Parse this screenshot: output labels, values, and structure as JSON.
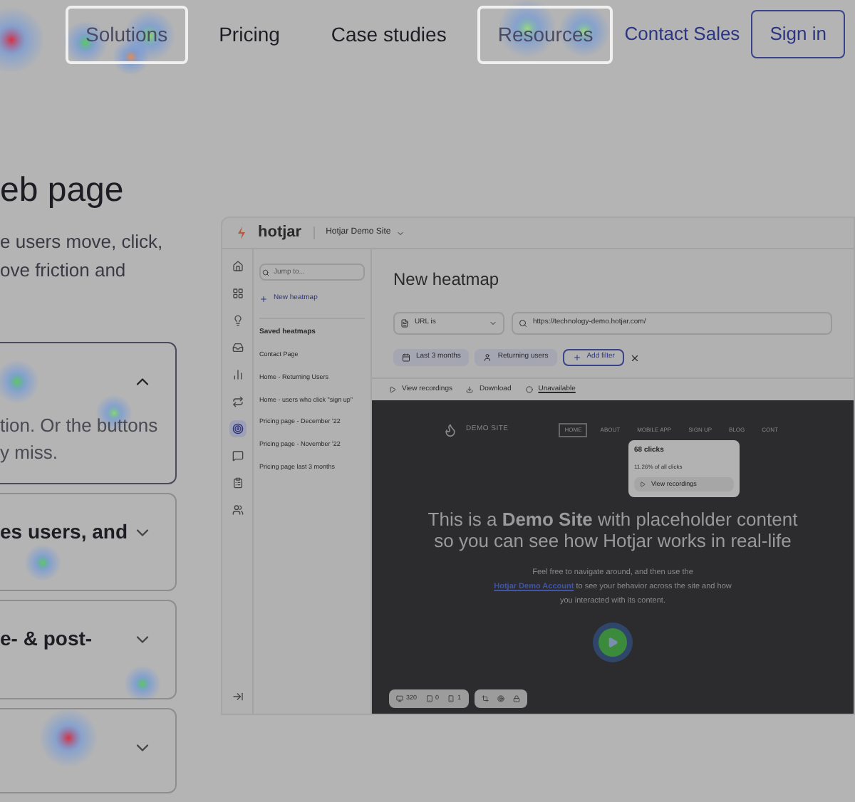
{
  "nav": {
    "items": [
      {
        "label": "Solutions",
        "highlighted": true
      },
      {
        "label": "Pricing",
        "highlighted": false
      },
      {
        "label": "Case studies",
        "highlighted": false
      },
      {
        "label": "Resources",
        "highlighted": true
      }
    ],
    "contact": "Contact Sales",
    "sign_in": "Sign in"
  },
  "hero": {
    "heading": "eb page",
    "lines": [
      "e users move, click,",
      "ove friction and"
    ]
  },
  "accordion": [
    {
      "expanded": true,
      "body": [
        "tion. Or the buttons",
        "y miss."
      ]
    },
    {
      "title": "es users, and",
      "expanded": false
    },
    {
      "title": "e- & post-",
      "expanded": false
    },
    {
      "expanded": false
    }
  ],
  "app": {
    "logo": "hotjar",
    "site": "Hotjar Demo Site",
    "search": {
      "placeholder": "Jump to..."
    },
    "new_button": "New heatmap",
    "saved_title": "Saved heatmaps",
    "saved": [
      "Contact Page",
      "Home - Returning Users",
      "Home - users who click \"sign up\"",
      "Pricing page - December '22",
      "Pricing page - November '22",
      "Pricing page last 3 months"
    ],
    "rail": [
      {
        "selected": false
      },
      {
        "selected": false
      },
      {
        "selected": false
      },
      {
        "selected": false
      },
      {
        "selected": false
      },
      {
        "selected": false
      },
      {
        "selected": true
      },
      {
        "selected": false
      },
      {
        "selected": false
      },
      {
        "selected": false
      }
    ],
    "title": "New heatmap",
    "url_rule": "URL is",
    "url": "https://technology-demo.hotjar.com/",
    "filters": [
      "Last 3 months",
      "Returning users"
    ],
    "add_filter": "Add filter",
    "actions": [
      "View recordings",
      "Download",
      "Unavailable"
    ],
    "demo": {
      "brand": "DEMO SITE",
      "menu": [
        {
          "label": "HOME",
          "selected": true
        },
        {
          "label": "ABOUT",
          "selected": false
        },
        {
          "label": "MOBILE APP",
          "selected": false
        },
        {
          "label": "SIGN UP",
          "selected": false
        },
        {
          "label": "BLOG",
          "selected": false
        },
        {
          "label": "CONT",
          "selected": false
        }
      ],
      "popup": {
        "clicks": "68 clicks",
        "share": "11.26% of all clicks",
        "button": "View recordings"
      },
      "headline": [
        "This is a **Demo Site** with placeholder content",
        "so you can see how Hotjar works in real-life"
      ],
      "text_before": "Feel free to navigate around, and then use the",
      "link": "Hotjar Demo Account",
      "text_after": "to see your behavior across the site and how you interacted with its content."
    },
    "toolbar": [
      "320",
      "0",
      "1"
    ]
  }
}
